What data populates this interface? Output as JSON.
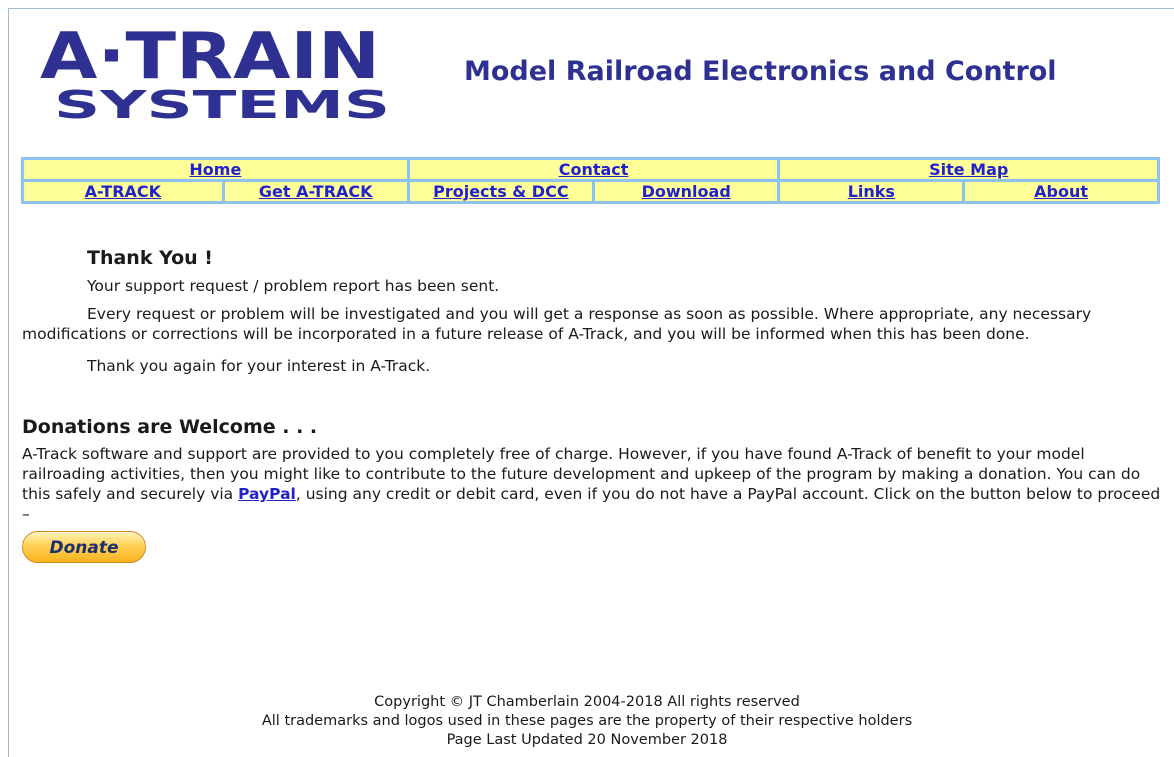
{
  "header": {
    "logo_text": [
      "A·TRAIN",
      "SYSTEMS"
    ],
    "site_title": "Model Railroad Electronics and Control"
  },
  "nav": {
    "row1": [
      "Home",
      "Contact",
      "Site Map"
    ],
    "row2": [
      "A-TRACK",
      "Get A-TRACK",
      "Projects & DCC",
      "Download",
      "Links",
      "About"
    ]
  },
  "thanks": {
    "heading": "Thank You !",
    "sent": "Your support request / problem report has been sent.",
    "body": "Every request or problem will be investigated and you will get a response as soon as possible. Where appropriate, any necessary modifications or corrections will be incorporated in a future release of A-Track, and you will be informed when this has been done.",
    "again": "Thank you again for your interest in A-Track."
  },
  "donations": {
    "heading": "Donations are Welcome . . .",
    "text_before": "A-Track software and support are provided to you completely free of charge. However, if you have found A-Track of benefit to your model railroading activities, then you might like to contribute to the future development and upkeep of the program by making a donation. You can do this safely and securely via ",
    "paypal_link": "PayPal",
    "text_after": ", using any credit or debit card, even if you do not have a PayPal account. Click on the button below to proceed –",
    "donate_button": "Donate"
  },
  "footer": {
    "copyright": "Copyright © JT Chamberlain 2004-2018  All rights reserved",
    "trademarks": "All trademarks and logos used in these pages are the property of their respective holders",
    "updated": "Page Last Updated  20 November 2018"
  },
  "colors": {
    "title": "#2e3192",
    "nav_bg": "#ffff99",
    "nav_border": "#8fc3ef",
    "link": "#2222cc",
    "logo": "#2e3192"
  },
  "icons": [
    "logo-image"
  ]
}
